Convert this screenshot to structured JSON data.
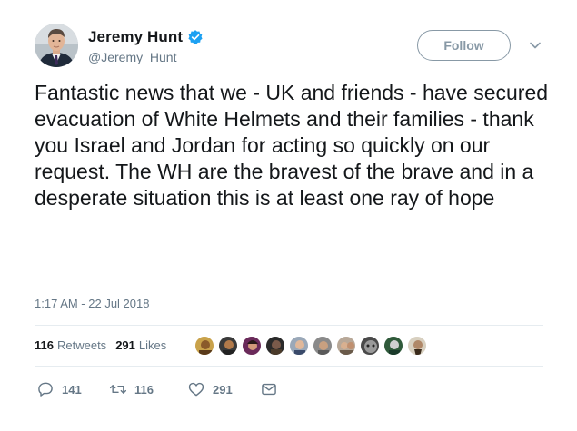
{
  "author": {
    "name": "Jeremy Hunt",
    "handle": "@Jeremy_Hunt",
    "verified": true
  },
  "follow_button": {
    "label": "Follow"
  },
  "tweet": {
    "text": "Fantastic news that we - UK and friends - have secured evacuation of White Helmets and their families - thank you Israel and Jordan for acting so quickly on our request. The WH are the bravest of the brave and in a desperate situation this is at least one ray of hope",
    "timestamp": "1:17 AM - 22 Jul 2018"
  },
  "stats": {
    "retweets_count": "116",
    "retweets_label": "Retweets",
    "likes_count": "291",
    "likes_label": "Likes"
  },
  "actions": {
    "reply_count": "141",
    "retweet_count": "116",
    "like_count": "291"
  },
  "colors": {
    "verified_blue": "#1da1f2",
    "secondary_text": "#657786",
    "divider": "#e6ecf0"
  },
  "icons": [
    "verified-badge",
    "chevron-down",
    "reply",
    "retweet",
    "heart",
    "direct-message"
  ]
}
